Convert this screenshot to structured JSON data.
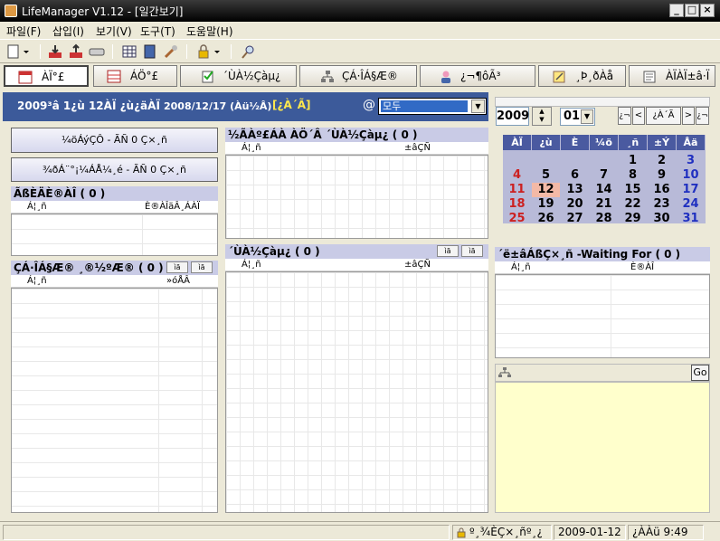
{
  "window": {
    "title": "LifeManager V1.12 - [일간보기]"
  },
  "menu": [
    "파일(F)",
    "삽입(I)",
    "보기(V)",
    "도구(T)",
    "도움말(H)"
  ],
  "tabs": [
    {
      "label": "ÀÏ°£",
      "icon": "calendar-icon"
    },
    {
      "label": "ÁÖ°£",
      "icon": "week-calendar-icon"
    },
    {
      "label": "´ÙÀ½Çàµ¿",
      "icon": "checklist-icon"
    },
    {
      "label": "ÇÁ·ÎÁ§Æ®",
      "icon": "project-icon"
    },
    {
      "label": "¿¬¶ôÃ³",
      "icon": "contact-icon"
    },
    {
      "label": "¸Þ¸ðÀå",
      "icon": "memo-icon"
    },
    {
      "label": "ÀÏÀÏ±â·Ï",
      "icon": "journal-icon"
    }
  ],
  "banner": {
    "date_text": "2009³â 1¿ù 12ÀÏ ¿ù¿äÀÏ",
    "iso_date": "2008/12/17 (Àü½Â)",
    "today_link": "[¿À´Ã]",
    "at_symbol": "@",
    "filter_value": "모두"
  },
  "left": {
    "btn_schedule": "¼öÁýÇÔ - ÃÑ 0 Ç×¸ñ",
    "btn_someday": "¾ðÁ¨°¡¼ÁÅ¼¸é - ÃÑ 0 Ç×¸ñ",
    "trash": {
      "title": "ÃßÈÄÈ®ÀÎ ( 0 )",
      "col1": "Á¦¸ñ",
      "col2": "È®ÀÎäÂ¸ÁÀÏ"
    },
    "project": {
      "title": "ÇÁ·ÎÁ§Æ® ¸®½ºÆ® ( 0 )",
      "col1": "Á¦¸ñ",
      "col2": "»óÅÂ",
      "btn1": "ìã",
      "btn2": "ìã"
    }
  },
  "middle": {
    "today_next": {
      "title": "½ÃÀº£ÁÀ ÀÖ´Â ´ÙÀ½Çàµ¿ ( 0 )",
      "col1": "Á¦¸ñ",
      "col2": "±âÇÑ"
    },
    "next_actions": {
      "title": "´ÙÀ½Çàµ¿ ( 0 )",
      "col1": "Á¦¸ñ",
      "col2": "±âÇÑ",
      "btn1": "ìã",
      "btn2": "ìã"
    }
  },
  "right": {
    "year": "2009",
    "month": "01",
    "nav": [
      "¿¬",
      "<",
      "¿À´Ã",
      ">",
      "¿¬"
    ],
    "weekdays": [
      "ÀÏ",
      "¿ù",
      "È­",
      "¼ö",
      "¸ñ",
      "±Ý",
      "Åä"
    ],
    "weeks": [
      [
        "",
        "",
        "",
        "",
        "1",
        "2",
        "3"
      ],
      [
        "4",
        "5",
        "6",
        "7",
        "8",
        "9",
        "10"
      ],
      [
        "11",
        "12",
        "13",
        "14",
        "15",
        "16",
        "17"
      ],
      [
        "18",
        "19",
        "20",
        "21",
        "22",
        "23",
        "24"
      ],
      [
        "25",
        "26",
        "27",
        "28",
        "29",
        "30",
        "31"
      ]
    ],
    "today_day": "12",
    "waiting": {
      "title": "´ë±âÁßÇ×¸ñ -Waiting For ( 0 )",
      "col1": "Á¦¸ñ",
      "col2": "È®ÀÎ"
    },
    "go_label": "Go"
  },
  "status": {
    "tasks": "º¸¾ÈÇ×¸ñº¸¿",
    "date": "2009-01-12",
    "time": "¿ÀÀü 9:49"
  },
  "colors": {
    "banner": "#3c5a9a",
    "header": "#c9cbe6",
    "memo_bg": "#ffffcc"
  }
}
